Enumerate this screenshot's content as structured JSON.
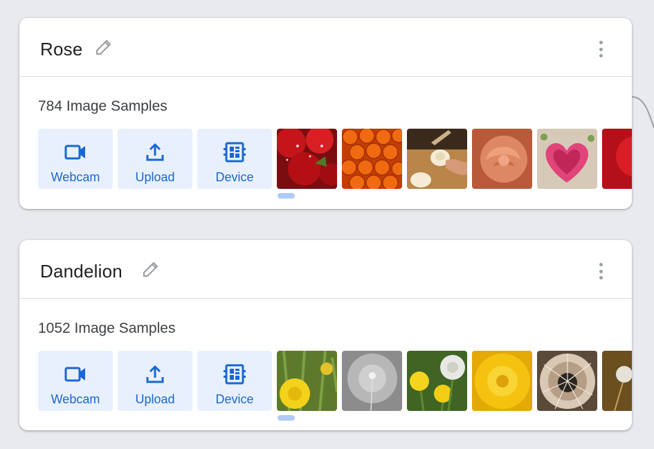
{
  "colors": {
    "background": "#e8eaed",
    "card": "#ffffff",
    "accent": "#1967d2",
    "button_bg": "#e8f0fe",
    "scroll_thumb": "#aecbfa"
  },
  "classes": [
    {
      "name": "Rose",
      "sample_count": "784 Image Samples",
      "buttons": [
        {
          "label": "Webcam",
          "icon": "videocam-icon"
        },
        {
          "label": "Upload",
          "icon": "upload-icon"
        },
        {
          "label": "Device",
          "icon": "device-icon"
        }
      ],
      "thumbnails": [
        "red-roses-with-droplets",
        "orange-roses-bunch",
        "cupcake-frosting",
        "peach-rose-closeup",
        "pink-heart-petals",
        "red-rose-partial"
      ]
    },
    {
      "name": "Dandelion",
      "sample_count": "1052 Image Samples",
      "buttons": [
        {
          "label": "Webcam",
          "icon": "videocam-icon"
        },
        {
          "label": "Upload",
          "icon": "upload-icon"
        },
        {
          "label": "Device",
          "icon": "device-icon"
        }
      ],
      "thumbnails": [
        "yellow-dandelion-grass",
        "grey-dandelion-seed",
        "dandelions-and-seedhead",
        "yellow-dandelion-closeup",
        "dandelion-seedhead-closeup",
        "dandelion-seedhead-partial"
      ]
    }
  ]
}
